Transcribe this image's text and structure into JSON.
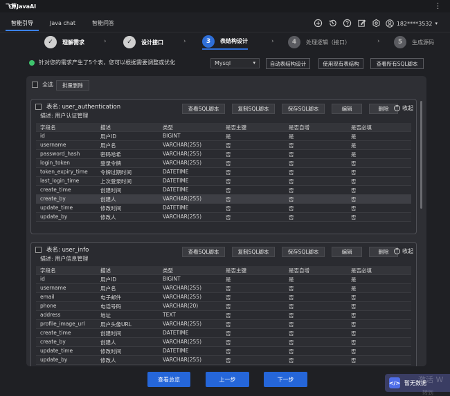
{
  "app": {
    "title": "飞算JavaAI",
    "more_icon": "more-vertical-icon"
  },
  "topnav": {
    "tabs": [
      {
        "label": "智能引导",
        "active": true
      },
      {
        "label": "Java chat",
        "active": false
      },
      {
        "label": "智能问答",
        "active": false
      }
    ],
    "icons": [
      "plus-circle-icon",
      "history-icon",
      "help-icon",
      "edit-icon",
      "settings-icon"
    ],
    "user": {
      "phone": "182****3532",
      "icon": "user-icon"
    }
  },
  "steps": [
    {
      "label": "理解需求",
      "state": "done",
      "number": ""
    },
    {
      "label": "设计接口",
      "state": "done",
      "number": ""
    },
    {
      "label": "表结构设计",
      "state": "current",
      "number": "3"
    },
    {
      "label": "处理逻辑（接口）",
      "state": "todo",
      "number": "4"
    },
    {
      "label": "生成源码",
      "state": "todo",
      "number": "5"
    }
  ],
  "info": {
    "text": "针对您的需求产生了5个表，您可以根据需要调整或优化",
    "db_selected": "Mysql",
    "actions": {
      "auto_design": "自动表结构设计",
      "use_existing": "使用现有表结构",
      "view_all_sql": "查看所有SQL脚本"
    }
  },
  "panel": {
    "select_all": "全选",
    "batch_delete": "批量删除",
    "card_buttons": {
      "view_sql": "查看SQL脚本",
      "copy_sql": "复制SQL脚本",
      "save_sql": "保存SQL脚本",
      "edit": "编辑",
      "delete": "删除",
      "collapse": "收起"
    },
    "columns": [
      "字段名",
      "描述",
      "类型",
      "是否主键",
      "是否自增",
      "是否必填"
    ],
    "tables": [
      {
        "name": "表名: user_authentication",
        "desc": "描述: 用户认证管理",
        "rows": [
          [
            "id",
            "用户ID",
            "BIGINT",
            "是",
            "是",
            "是"
          ],
          [
            "username",
            "用户名",
            "VARCHAR(255)",
            "否",
            "否",
            "是"
          ],
          [
            "password_hash",
            "密码哈希",
            "VARCHAR(255)",
            "否",
            "否",
            "是"
          ],
          [
            "login_token",
            "登录令牌",
            "VARCHAR(255)",
            "否",
            "否",
            "否"
          ],
          [
            "token_expiry_time",
            "令牌过期时间",
            "DATETIME",
            "否",
            "否",
            "否"
          ],
          [
            "last_login_time",
            "上次登录时间",
            "DATETIME",
            "否",
            "否",
            "否"
          ],
          [
            "create_time",
            "创建时间",
            "DATETIME",
            "否",
            "否",
            "否"
          ],
          [
            "create_by",
            "创建人",
            "VARCHAR(255)",
            "否",
            "否",
            "否"
          ],
          [
            "update_time",
            "修改时间",
            "DATETIME",
            "否",
            "否",
            "否"
          ],
          [
            "update_by",
            "修改人",
            "VARCHAR(255)",
            "否",
            "否",
            "否"
          ]
        ]
      },
      {
        "name": "表名: user_info",
        "desc": "描述: 用户信息管理",
        "rows": [
          [
            "id",
            "用户ID",
            "BIGINT",
            "是",
            "是",
            "是"
          ],
          [
            "username",
            "用户名",
            "VARCHAR(255)",
            "否",
            "否",
            "是"
          ],
          [
            "email",
            "电子邮件",
            "VARCHAR(255)",
            "否",
            "否",
            "否"
          ],
          [
            "phone",
            "电话号码",
            "VARCHAR(20)",
            "否",
            "否",
            "否"
          ],
          [
            "address",
            "地址",
            "TEXT",
            "否",
            "否",
            "否"
          ],
          [
            "profile_image_url",
            "用户头像URL",
            "VARCHAR(255)",
            "否",
            "否",
            "否"
          ],
          [
            "create_time",
            "创建时间",
            "DATETIME",
            "否",
            "否",
            "否"
          ],
          [
            "create_by",
            "创建人",
            "VARCHAR(255)",
            "否",
            "否",
            "否"
          ],
          [
            "update_time",
            "修改时间",
            "DATETIME",
            "否",
            "否",
            "否"
          ],
          [
            "update_by",
            "修改人",
            "VARCHAR(255)",
            "否",
            "否",
            "否"
          ]
        ]
      }
    ]
  },
  "bottom": {
    "view_summary": "查看总览",
    "prev": "上一步",
    "next": "下一步",
    "float_label": "暂无数据",
    "watermark": "激活 W",
    "watermark2": "转到"
  },
  "colors": {
    "accent": "#2566d9",
    "success": "#3ec46d",
    "background": "#1f2024",
    "panel": "#2e2f34"
  }
}
